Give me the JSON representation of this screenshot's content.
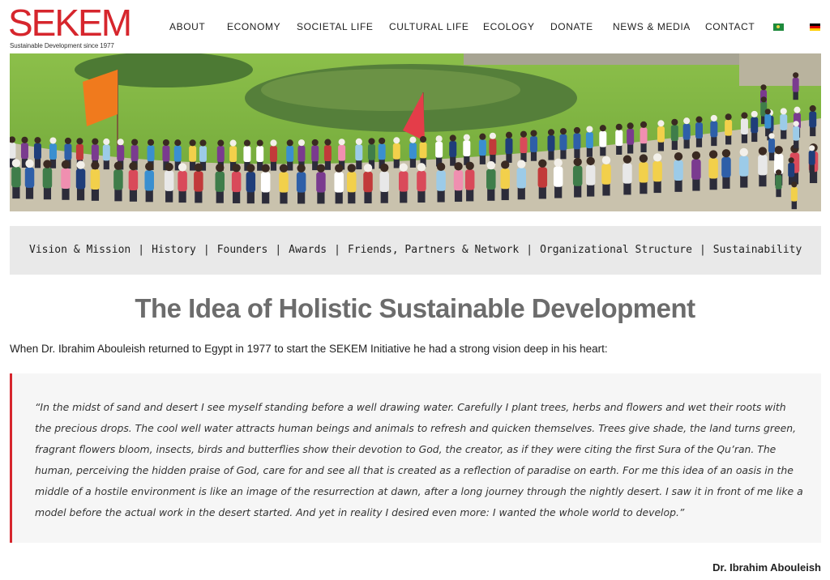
{
  "brand": {
    "name": "SEKEM",
    "tagline": "Sustainable Development since 1977",
    "color": "#d6262d"
  },
  "nav": {
    "items": [
      "ABOUT",
      "ECONOMY",
      "SOCIETAL LIFE",
      "CULTURAL LIFE",
      "ECOLOGY",
      "DONATE",
      "NEWS & MEDIA",
      "CONTACT"
    ]
  },
  "languages": [
    "egypt-flag-icon",
    "germany-flag-icon"
  ],
  "subnav": {
    "items": [
      "Vision & Mission",
      "History",
      "Founders",
      "Awards",
      "Friends, Partners & Network",
      "Organizational Structure",
      "Sustainability"
    ],
    "separator": "|"
  },
  "page": {
    "title": "The Idea of Holistic Sustainable Development",
    "intro": "When Dr. Ibrahim Abouleish returned to Egypt in 1977 to start the SEKEM Initiative he had a strong vision deep in his heart:",
    "quote": "“In the midst of sand and desert I see myself standing before a well drawing water. Carefully I plant trees, herbs and flowers and wet their roots with the precious drops. The cool well water attracts human beings and animals to refresh and quicken themselves. Trees give shade, the land turns green, fragrant flowers bloom, insects, birds and butterflies show their devotion to God, the creator, as if they were citing the first Sura of the Qu’ran. The human, perceiving the hidden praise of God, care for and see all that is created as a reflection of paradise on earth. For me this idea of an oasis in the middle of a hostile environment is like an image of the resurrection at dawn, after a long journey through the nightly desert. I saw it in front of me like a model before the actual work in the desert started. And yet in reality I desired even more: I wanted the whole world to develop.”",
    "author": "Dr. Ibrahim Abouleish"
  }
}
